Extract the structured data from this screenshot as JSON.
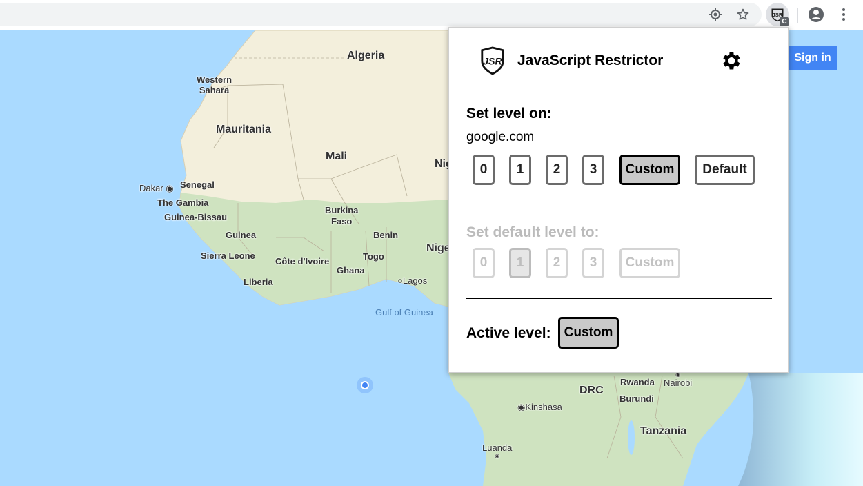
{
  "toolbar": {
    "icons": [
      "location-icon",
      "star-icon",
      "profile-icon",
      "menu-icon"
    ],
    "extension": {
      "icon": "jsr-logo-icon",
      "badge": "C"
    }
  },
  "map": {
    "sign_in": "Sign in",
    "labels": {
      "algeria": "Algeria",
      "western_sahara": "Western\nSahara",
      "mauritania": "Mauritania",
      "mali": "Mali",
      "niger": "Nig",
      "nigeria": "Nige",
      "dakar": "Dakar",
      "senegal": "Senegal",
      "the_gambia": "The Gambia",
      "guinea_bissau": "Guinea-Bissau",
      "guinea": "Guinea",
      "burkina_faso": "Burkina\nFaso",
      "benin": "Benin",
      "sierra_leone": "Sierra Leone",
      "cote_divoire": "Côte d'Ivoire",
      "togo": "Togo",
      "ghana": "Ghana",
      "liberia": "Liberia",
      "lagos": "Lagos",
      "gulf_of_guinea": "Gulf of Guinea",
      "drc": "DRC",
      "rwanda": "Rwanda",
      "nairobi": "Nairobi",
      "burundi": "Burundi",
      "kinshasa": "Kinshasa",
      "tanzania": "Tanzania",
      "luanda": "Luanda"
    }
  },
  "popup": {
    "title": "JavaScript Restrictor",
    "set_level_title": "Set level on:",
    "domain": "google.com",
    "level_buttons": [
      "0",
      "1",
      "2",
      "3",
      "Custom",
      "Default"
    ],
    "selected_level": "Custom",
    "default_level_title": "Set default level to:",
    "default_buttons": [
      "0",
      "1",
      "2",
      "3",
      "Custom"
    ],
    "default_selected": "1",
    "active_level_title": "Active level:",
    "active_level": "Custom"
  }
}
